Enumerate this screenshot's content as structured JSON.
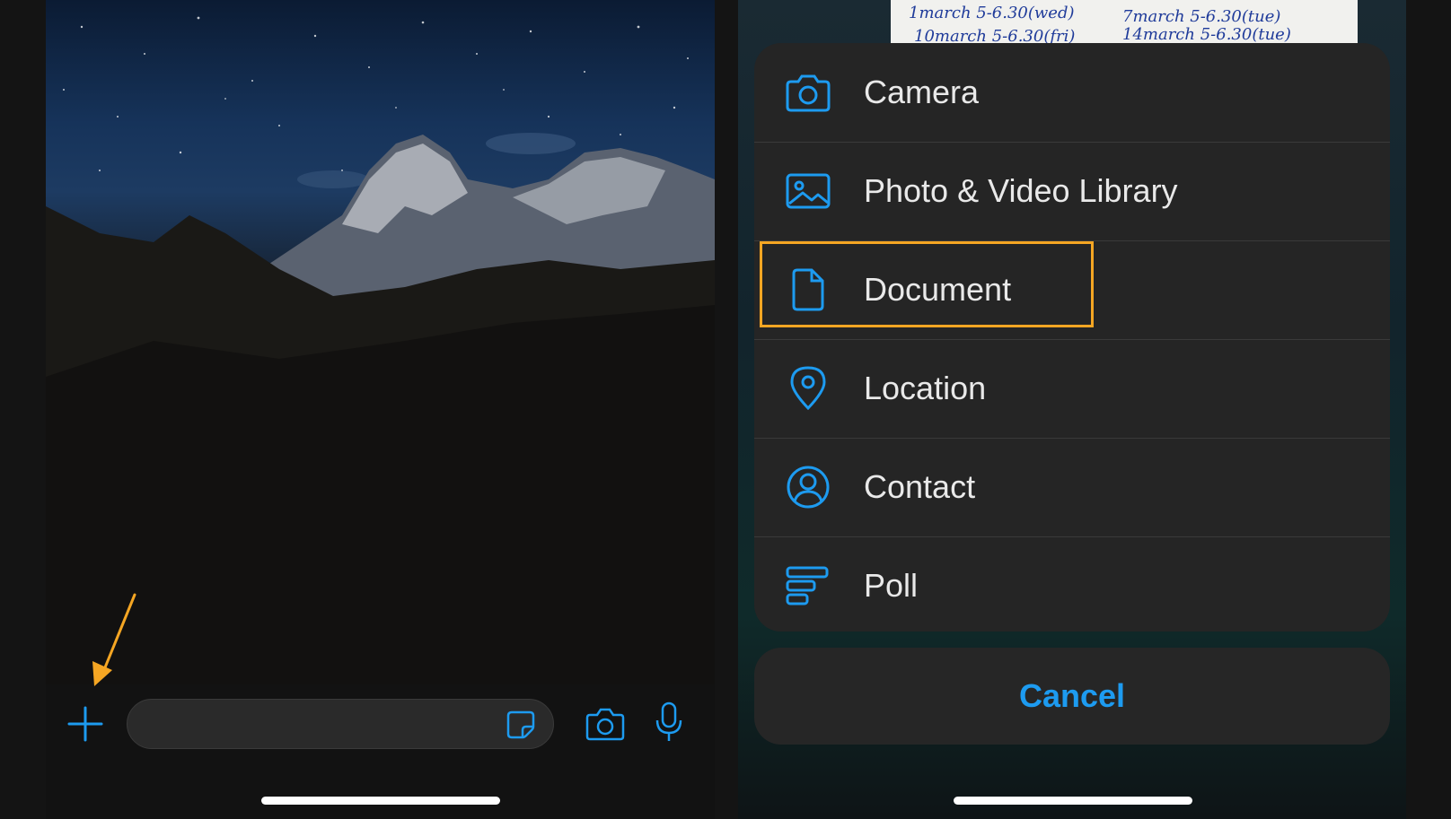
{
  "attachment_sheet": {
    "items": [
      {
        "label": "Camera",
        "icon": "camera-icon"
      },
      {
        "label": "Photo & Video Library",
        "icon": "photo-icon"
      },
      {
        "label": "Document",
        "icon": "document-icon"
      },
      {
        "label": "Location",
        "icon": "location-pin-icon"
      },
      {
        "label": "Contact",
        "icon": "contact-icon"
      },
      {
        "label": "Poll",
        "icon": "poll-icon"
      }
    ],
    "cancel_label": "Cancel",
    "highlighted_item": "Document"
  },
  "background_note": {
    "line1a": "1march 5-6.30(wed)",
    "line1b": "7march 5-6.30(tue)",
    "line2a": "10march 5-6.30(fri)",
    "line2b": "14march 5-6.30(tue)"
  },
  "composer": {
    "message_value": "",
    "message_placeholder": ""
  },
  "colors": {
    "accent": "#1d9bf0",
    "annotation": "#f5a623",
    "sheet": "#252525",
    "text": "#e9e9e9"
  }
}
